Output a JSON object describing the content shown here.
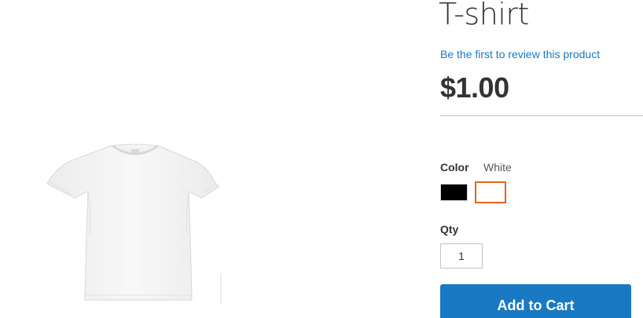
{
  "product": {
    "title": "T-shirt",
    "review_link": "Be the first to review this product",
    "price": "$1.00"
  },
  "options": {
    "color_label": "Color",
    "color_selected": "White",
    "swatches": [
      {
        "name": "Black",
        "color": "#000000",
        "selected": false
      },
      {
        "name": "White",
        "color": "#ffffff",
        "selected": true
      }
    ]
  },
  "quantity": {
    "label": "Qty",
    "value": "1"
  },
  "actions": {
    "add_to_cart_label": "Add to Cart"
  },
  "theme": {
    "accent": "#1979c3",
    "selected_swatch_border": "#e0681a",
    "text": "#333333"
  },
  "images": {
    "main": "white-tshirt-image"
  }
}
